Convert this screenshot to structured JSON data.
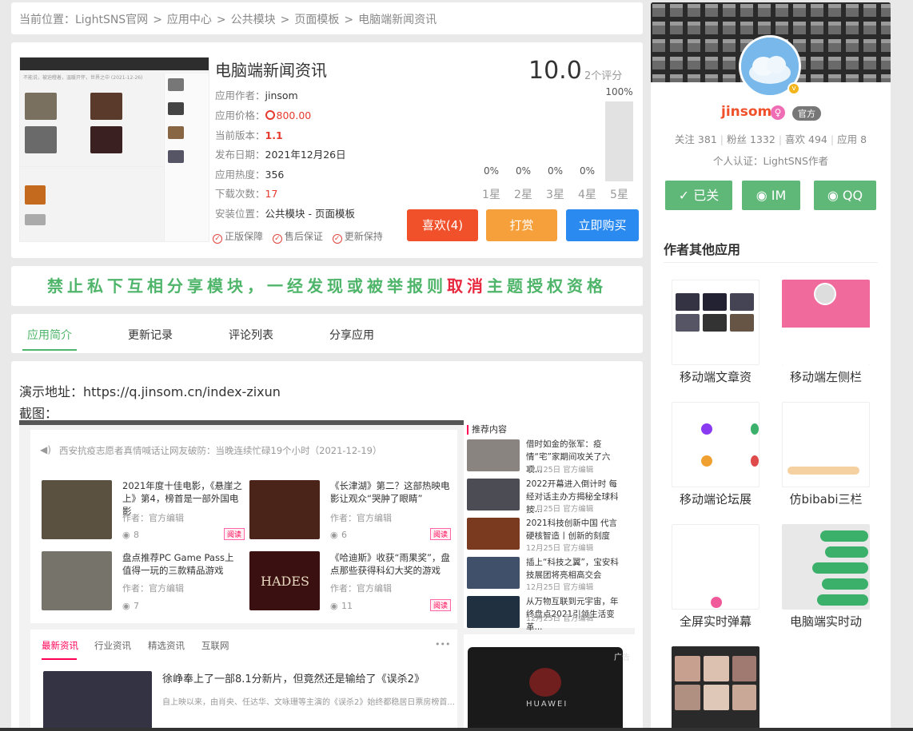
{
  "breadcrumb": {
    "prefix": "当前位置：",
    "items": [
      "LightSNS官网",
      "应用中心",
      "公共模块",
      "页面模板",
      "电脑端新闻资讯"
    ],
    "separator": ">"
  },
  "product": {
    "title": "电脑端新闻资讯",
    "author_label": "应用作者：",
    "author": "jinsom",
    "price_label": "应用价格：",
    "price": "800.00",
    "version_label": "当前版本：",
    "version": "1.1",
    "date_label": "发布日期：",
    "date": "2021年12月26日",
    "heat_label": "应用热度：",
    "heat": "356",
    "downloads_label": "下载次数：",
    "downloads": "17",
    "location_label": "安装位置：",
    "location": "公共模块 - 页面模板",
    "guarantees": [
      "正版保障",
      "售后保证",
      "更新保持"
    ],
    "score": "10.0",
    "rating_count": "2个评分",
    "stars": [
      {
        "label": "1星",
        "pct": "0%",
        "fill": 0
      },
      {
        "label": "2星",
        "pct": "0%",
        "fill": 0
      },
      {
        "label": "3星",
        "pct": "0%",
        "fill": 0
      },
      {
        "label": "4星",
        "pct": "0%",
        "fill": 0
      },
      {
        "label": "5星",
        "pct": "100%",
        "fill": 1
      }
    ],
    "like_button": "喜欢(4)",
    "tip_button": "打赏",
    "buy_button": "立即购买",
    "thumb_caption": "不能说，被迫瞪着，温暖开怀，世界之中 (2021-12-26)"
  },
  "notice": {
    "before": "禁止私下互相分享模块，一经发现或被举报则",
    "highlight": "取消",
    "after": "主题授权资格"
  },
  "tabs": [
    "应用简介",
    "更新记录",
    "评论列表",
    "分享应用"
  ],
  "content": {
    "demo_label": "演示地址：",
    "demo_url": "https://q.jinsom.cn/index-zixun",
    "screenshot_label": "截图：",
    "shot": {
      "notice_text": "西安抗疫志愿者真情喊话让网友破防：当晚连续忙碌19个小时（2021-12-19）",
      "articles": [
        {
          "title": "2021年度十佳电影，《悬崖之上》第4，榜首是一部外国电影",
          "author": "作者：官方编辑",
          "views": "8",
          "tag": "阅读"
        },
        {
          "title": "《长津湖》第二？这部热映电影让观众“哭肿了眼睛”",
          "author": "作者：官方编辑",
          "views": "6",
          "tag": "阅读"
        },
        {
          "title": "盘点推荐PC Game Pass上值得一玩的三款精品游戏",
          "author": "作者：官方编辑",
          "views": "7",
          "tag": "阅读"
        },
        {
          "title": "《哈迪斯》收获“雨果奖”，盘点那些获得科幻大奖的游戏",
          "author": "作者：官方编辑",
          "views": "11",
          "tag": "阅读"
        }
      ],
      "recommend_title": "推荐内容",
      "recommend": [
        {
          "title": "借时如金的张军：疫情“宅”家期间攻关了六项...",
          "meta": "12月25日  官方编辑"
        },
        {
          "title": "2022开幕进入倒计时 每经对话主办方揭秘全球科技...",
          "meta": "12月25日  官方编辑"
        },
        {
          "title": "2021科技创新中国 代言硬核智造丨创新的刻度",
          "meta": "12月25日  官方编辑"
        },
        {
          "title": "插上“科技之翼”，宝安科技展团将亮相高交会",
          "meta": "12月25日  官方编辑"
        },
        {
          "title": "从万物互联到元宇宙，年终盘点2021引领生活变革...",
          "meta": "12月25日  官方编辑"
        }
      ],
      "news_tabs": [
        "最新资讯",
        "行业资讯",
        "精选资讯",
        "互联网"
      ],
      "more": "•••",
      "latest_title": "徐峥奉上了一部8.1分新片，但竟然还是输给了《误杀2》",
      "latest_summary": "自上映以来，由肖央、任达华、文咏珊等主演的《误杀2》始终都稳居日票房榜首...",
      "ad_label": "广告",
      "ad_brand": "HUAWEI",
      "game_title": "HADES"
    }
  },
  "sidebar": {
    "username": "jinsom",
    "female_symbol": "♀",
    "official_badge": "官方",
    "verified_symbol": "v",
    "stats": [
      {
        "label": "关注",
        "value": "381"
      },
      {
        "label": "粉丝",
        "value": "1332"
      },
      {
        "label": "喜欢",
        "value": "494"
      },
      {
        "label": "应用",
        "value": "8"
      }
    ],
    "certification": "个人认证：LightSNS作者",
    "buttons": [
      "已关",
      "IM",
      "QQ"
    ],
    "section_title": "作者其他应用",
    "apps": [
      {
        "label": "移动端文章资"
      },
      {
        "label": "移动端左侧栏"
      },
      {
        "label": "移动端论坛展"
      },
      {
        "label": "仿bibabi三栏"
      },
      {
        "label": "全屏实时弹幕"
      },
      {
        "label": "电脑端实时动"
      }
    ]
  },
  "colors": {
    "accent_green": "#4fb56a",
    "like_red": "#f0502a",
    "tip_orange": "#f5a03b",
    "buy_blue": "#2b8af0",
    "notice_red": "#e8283e"
  }
}
